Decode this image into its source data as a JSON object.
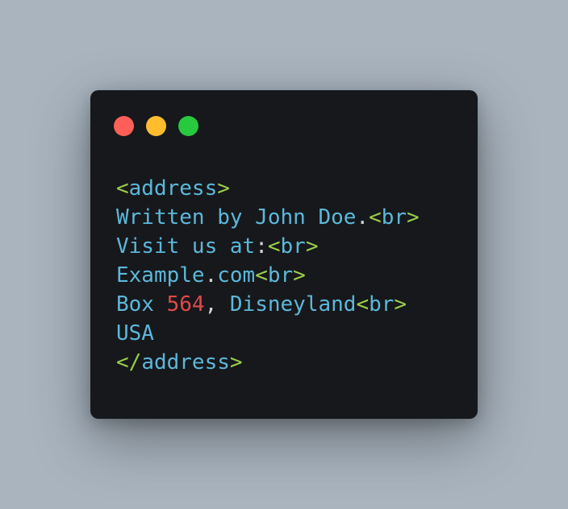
{
  "window": {
    "controls": [
      {
        "name": "close",
        "color": "#ff5f56"
      },
      {
        "name": "minimize",
        "color": "#ffbd2e"
      },
      {
        "name": "maximize",
        "color": "#27c93f"
      }
    ]
  },
  "code": {
    "lt": "<",
    "gt": ">",
    "lt_slash": "</",
    "tag_address": "address",
    "tag_br": "br",
    "dot": ".",
    "colon": ":",
    "comma": ",",
    "line2_text": "Written by John Doe",
    "line3_text": "Visit us at",
    "line4_part1": "Example",
    "line4_part2": "com",
    "line5_part1": "Box ",
    "line5_number": "564",
    "line5_part2": " Disneyland",
    "line6_text": "USA"
  },
  "colors": {
    "background": "#a9b4bf",
    "window": "#16181b",
    "bracket": "#9bcf48",
    "tag": "#5cb8db",
    "text": "#5cb8db",
    "punctuation": "#d2d4d6",
    "number": "#e04a4a"
  }
}
